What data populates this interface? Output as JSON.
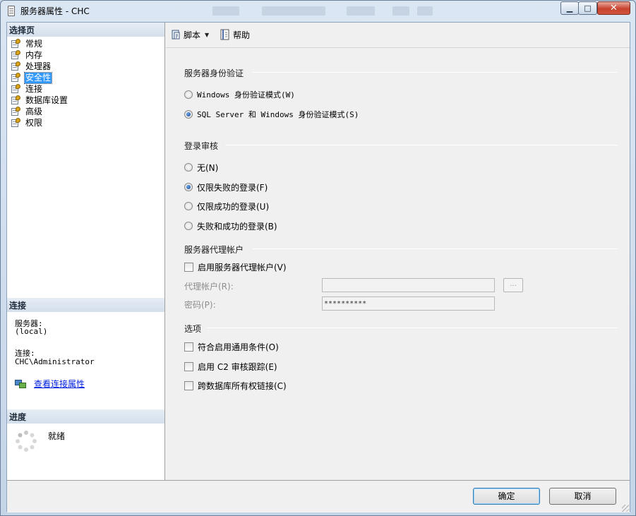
{
  "window": {
    "title": "服务器属性 - CHC",
    "controls": {
      "minimize": "▁",
      "maximize": "□",
      "close": "✕"
    }
  },
  "left_pane": {
    "select_page_header": "选择页",
    "pages": [
      {
        "label": "常规",
        "icon": "page-wrench-icon"
      },
      {
        "label": "内存",
        "icon": "page-wrench-icon"
      },
      {
        "label": "处理器",
        "icon": "page-wrench-icon"
      },
      {
        "label": "安全性",
        "icon": "page-wrench-icon",
        "selected": true
      },
      {
        "label": "连接",
        "icon": "page-wrench-icon"
      },
      {
        "label": "数据库设置",
        "icon": "page-wrench-icon"
      },
      {
        "label": "高级",
        "icon": "page-wrench-icon"
      },
      {
        "label": "权限",
        "icon": "page-wrench-icon"
      }
    ],
    "connection_header": "连接",
    "server_label": "服务器:",
    "server_value": "(local)",
    "connection_label": "连接:",
    "connection_value": "CHC\\Administrator",
    "view_connection_link": "查看连接属性",
    "progress_header": "进度",
    "progress_status": "就绪"
  },
  "toolbar": {
    "script_label": "脚本",
    "help_label": "帮助"
  },
  "auth": {
    "title": "服务器身份验证",
    "options": [
      {
        "label": "Windows 身份验证模式(W)",
        "checked": false
      },
      {
        "label": "SQL Server 和 Windows 身份验证模式(S)",
        "checked": true
      }
    ]
  },
  "audit": {
    "title": "登录审核",
    "options": [
      {
        "label": "无(N)",
        "checked": false
      },
      {
        "label": "仅限失败的登录(F)",
        "checked": true
      },
      {
        "label": "仅限成功的登录(U)",
        "checked": false
      },
      {
        "label": "失败和成功的登录(B)",
        "checked": false
      }
    ]
  },
  "proxy": {
    "title": "服务器代理帐户",
    "enable_label": "启用服务器代理帐户(V)",
    "enable_checked": false,
    "account_label": "代理帐户(R):",
    "account_value": "",
    "password_label": "密码(P):",
    "password_value": "**********",
    "browse_label": "..."
  },
  "options": {
    "title": "选项",
    "items": [
      {
        "label": "符合启用通用条件(O)",
        "checked": false
      },
      {
        "label": "启用 C2 审核跟踪(E)",
        "checked": false
      },
      {
        "label": "跨数据库所有权链接(C)",
        "checked": false
      }
    ]
  },
  "footer": {
    "ok_label": "确定",
    "cancel_label": "取消"
  }
}
